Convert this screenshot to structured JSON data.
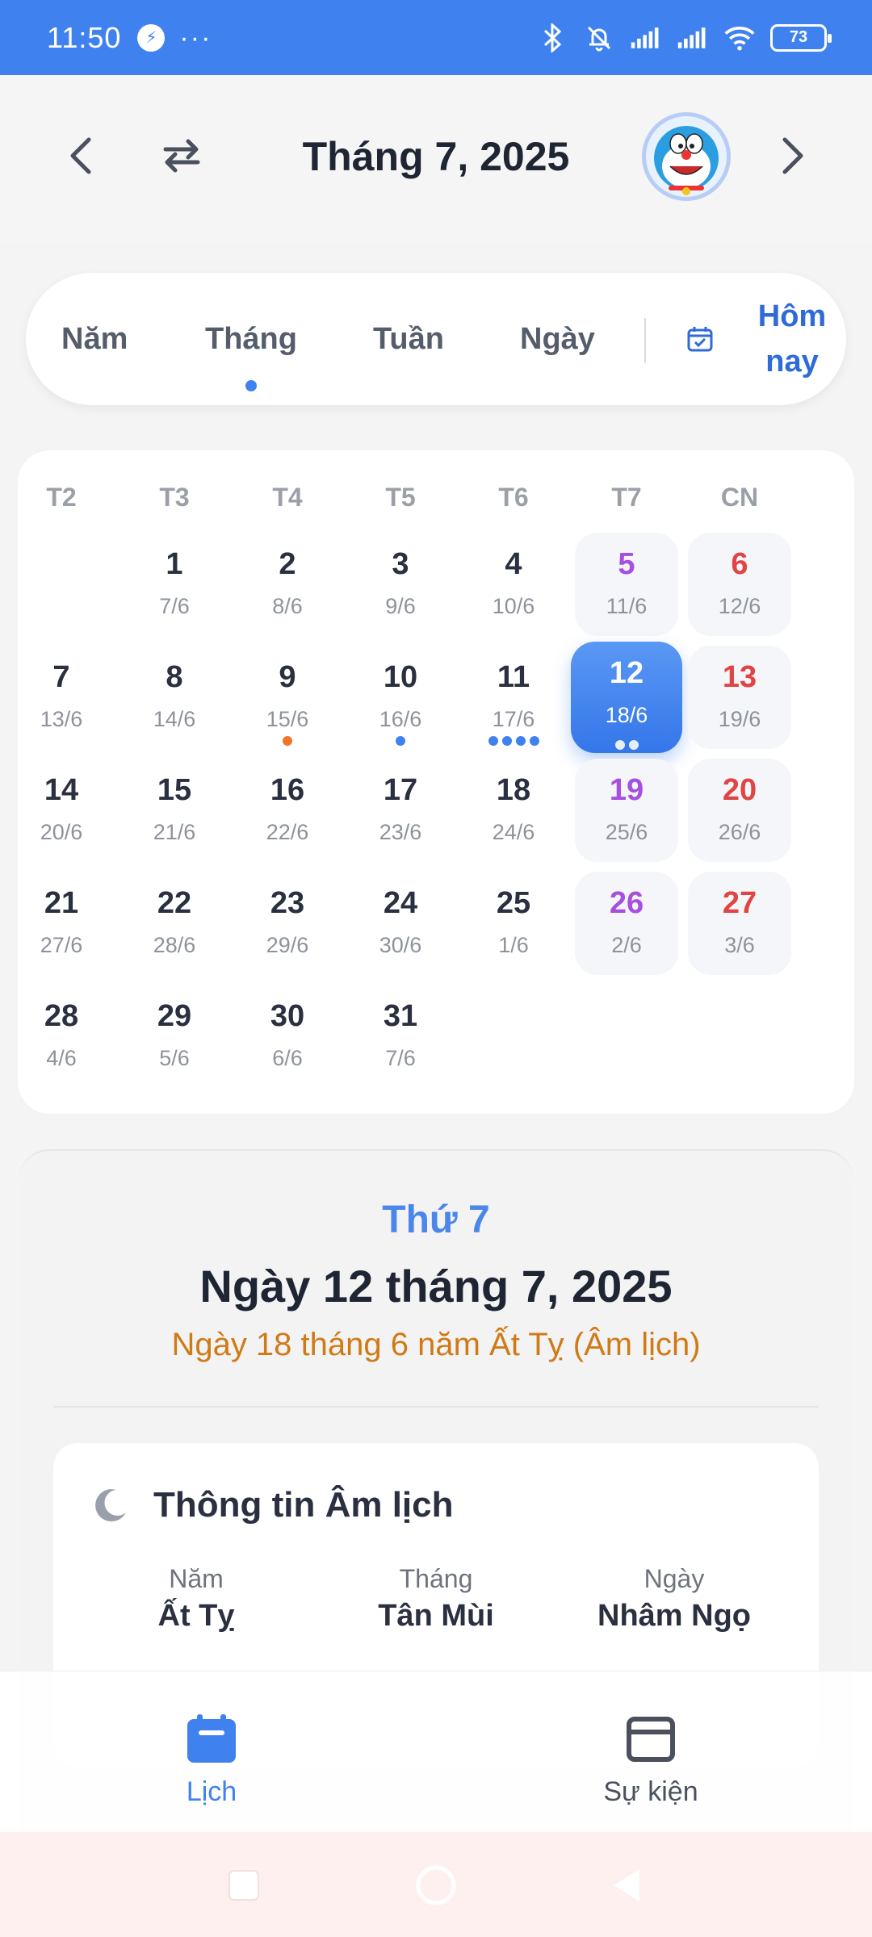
{
  "status_bar": {
    "time": "11:50",
    "battery": "73"
  },
  "header": {
    "title": "Tháng 7, 2025"
  },
  "view_tabs": {
    "items": [
      "Năm",
      "Tháng",
      "Tuần",
      "Ngày"
    ],
    "active": "Tháng",
    "today_line1": "Hôm",
    "today_line2": "nay"
  },
  "calendar": {
    "weekdays": [
      "T2",
      "T3",
      "T4",
      "T5",
      "T6",
      "T7",
      "CN"
    ],
    "weeks": [
      [
        null,
        {
          "d": "1",
          "l": "7/6"
        },
        {
          "d": "2",
          "l": "8/6"
        },
        {
          "d": "3",
          "l": "9/6"
        },
        {
          "d": "4",
          "l": "10/6"
        },
        {
          "d": "5",
          "l": "11/6"
        },
        {
          "d": "6",
          "l": "12/6"
        }
      ],
      [
        {
          "d": "7",
          "l": "13/6"
        },
        {
          "d": "8",
          "l": "14/6"
        },
        {
          "d": "9",
          "l": "15/6",
          "dots": [
            "orange"
          ]
        },
        {
          "d": "10",
          "l": "16/6",
          "dots": [
            "blue"
          ]
        },
        {
          "d": "11",
          "l": "17/6",
          "dots": [
            "blue",
            "blue",
            "blue",
            "blue"
          ]
        },
        {
          "d": "12",
          "l": "18/6",
          "selected": true,
          "dots": [
            "white",
            "white"
          ]
        },
        {
          "d": "13",
          "l": "19/6"
        }
      ],
      [
        {
          "d": "14",
          "l": "20/6"
        },
        {
          "d": "15",
          "l": "21/6"
        },
        {
          "d": "16",
          "l": "22/6"
        },
        {
          "d": "17",
          "l": "23/6"
        },
        {
          "d": "18",
          "l": "24/6"
        },
        {
          "d": "19",
          "l": "25/6"
        },
        {
          "d": "20",
          "l": "26/6"
        }
      ],
      [
        {
          "d": "21",
          "l": "27/6"
        },
        {
          "d": "22",
          "l": "28/6"
        },
        {
          "d": "23",
          "l": "29/6"
        },
        {
          "d": "24",
          "l": "30/6"
        },
        {
          "d": "25",
          "l": "1/6"
        },
        {
          "d": "26",
          "l": "2/6"
        },
        {
          "d": "27",
          "l": "3/6"
        }
      ],
      [
        {
          "d": "28",
          "l": "4/6"
        },
        {
          "d": "29",
          "l": "5/6"
        },
        {
          "d": "30",
          "l": "6/6"
        },
        {
          "d": "31",
          "l": "7/6"
        },
        null,
        null,
        null
      ]
    ]
  },
  "detail": {
    "weekday": "Thứ 7",
    "date": "Ngày 12 tháng 7, 2025",
    "lunar_date": "Ngày 18 tháng 6 năm Ất Tỵ (Âm lịch)",
    "info_title": "Thông tin Âm lịch",
    "year_label": "Năm",
    "year_value": "Ất Tỵ",
    "month_label": "Tháng",
    "month_value": "Tân Mùi",
    "day_label": "Ngày",
    "day_value": "Nhâm Ngọ"
  },
  "bottom_nav": {
    "calendar_label": "Lịch",
    "events_label": "Sự kiện"
  },
  "colors": {
    "accent": "#3f82ef",
    "saturday": "#a64fe0",
    "sunday": "#e04444",
    "lunar": "#d07a16"
  }
}
